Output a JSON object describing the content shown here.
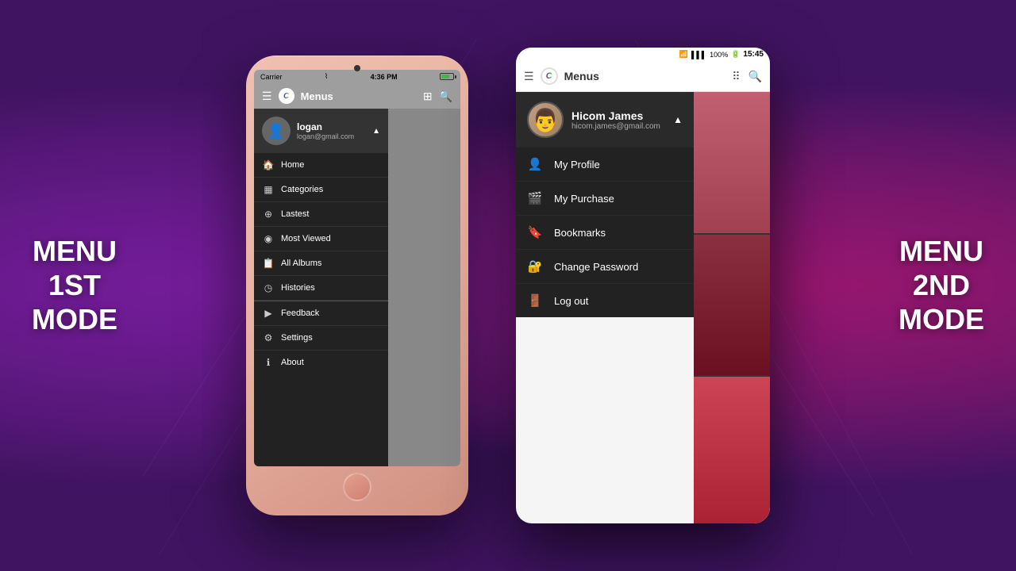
{
  "background": {
    "color_left": "#3d0a6b",
    "color_right": "#6b0a3d"
  },
  "left_label": {
    "line1": "MENU",
    "line2": "1ST",
    "line3": "MODE"
  },
  "right_label": {
    "line1": "MENU",
    "line2": "2ND",
    "line3": "MODE"
  },
  "iphone": {
    "statusbar": {
      "carrier": "Carrier",
      "wifi": "📶",
      "time": "4:36 PM",
      "battery": "70%"
    },
    "toolbar": {
      "app_name": "Menus",
      "logo": "C"
    },
    "drawer": {
      "user": {
        "name": "logan",
        "email": "logan@gmail.com"
      },
      "menu_items": [
        {
          "icon": "🏠",
          "label": "Home"
        },
        {
          "icon": "▦",
          "label": "Categories"
        },
        {
          "icon": "⊕",
          "label": "Lastest"
        },
        {
          "icon": "👁",
          "label": "Most Viewed"
        },
        {
          "icon": "📋",
          "label": "All Albums"
        },
        {
          "icon": "🕐",
          "label": "Histories"
        },
        {
          "icon": "▶",
          "label": "Feedback"
        },
        {
          "icon": "⚙",
          "label": "Settings"
        },
        {
          "icon": "ℹ",
          "label": "About"
        }
      ]
    }
  },
  "android": {
    "statusbar": {
      "wifi": "📶",
      "signal": "📶",
      "battery": "100%",
      "time": "15:45"
    },
    "toolbar": {
      "app_name": "Menus",
      "logo": "C"
    },
    "drawer": {
      "user": {
        "name": "Hicom James",
        "email": "hicom.james@gmail.com"
      },
      "menu_items": [
        {
          "icon": "👤",
          "label": "My Profile"
        },
        {
          "icon": "🎬",
          "label": "My Purchase"
        },
        {
          "icon": "🔖",
          "label": "Bookmarks"
        },
        {
          "icon": "🔑",
          "label": "Change Password"
        },
        {
          "icon": "🚪",
          "label": "Log out"
        }
      ]
    }
  }
}
